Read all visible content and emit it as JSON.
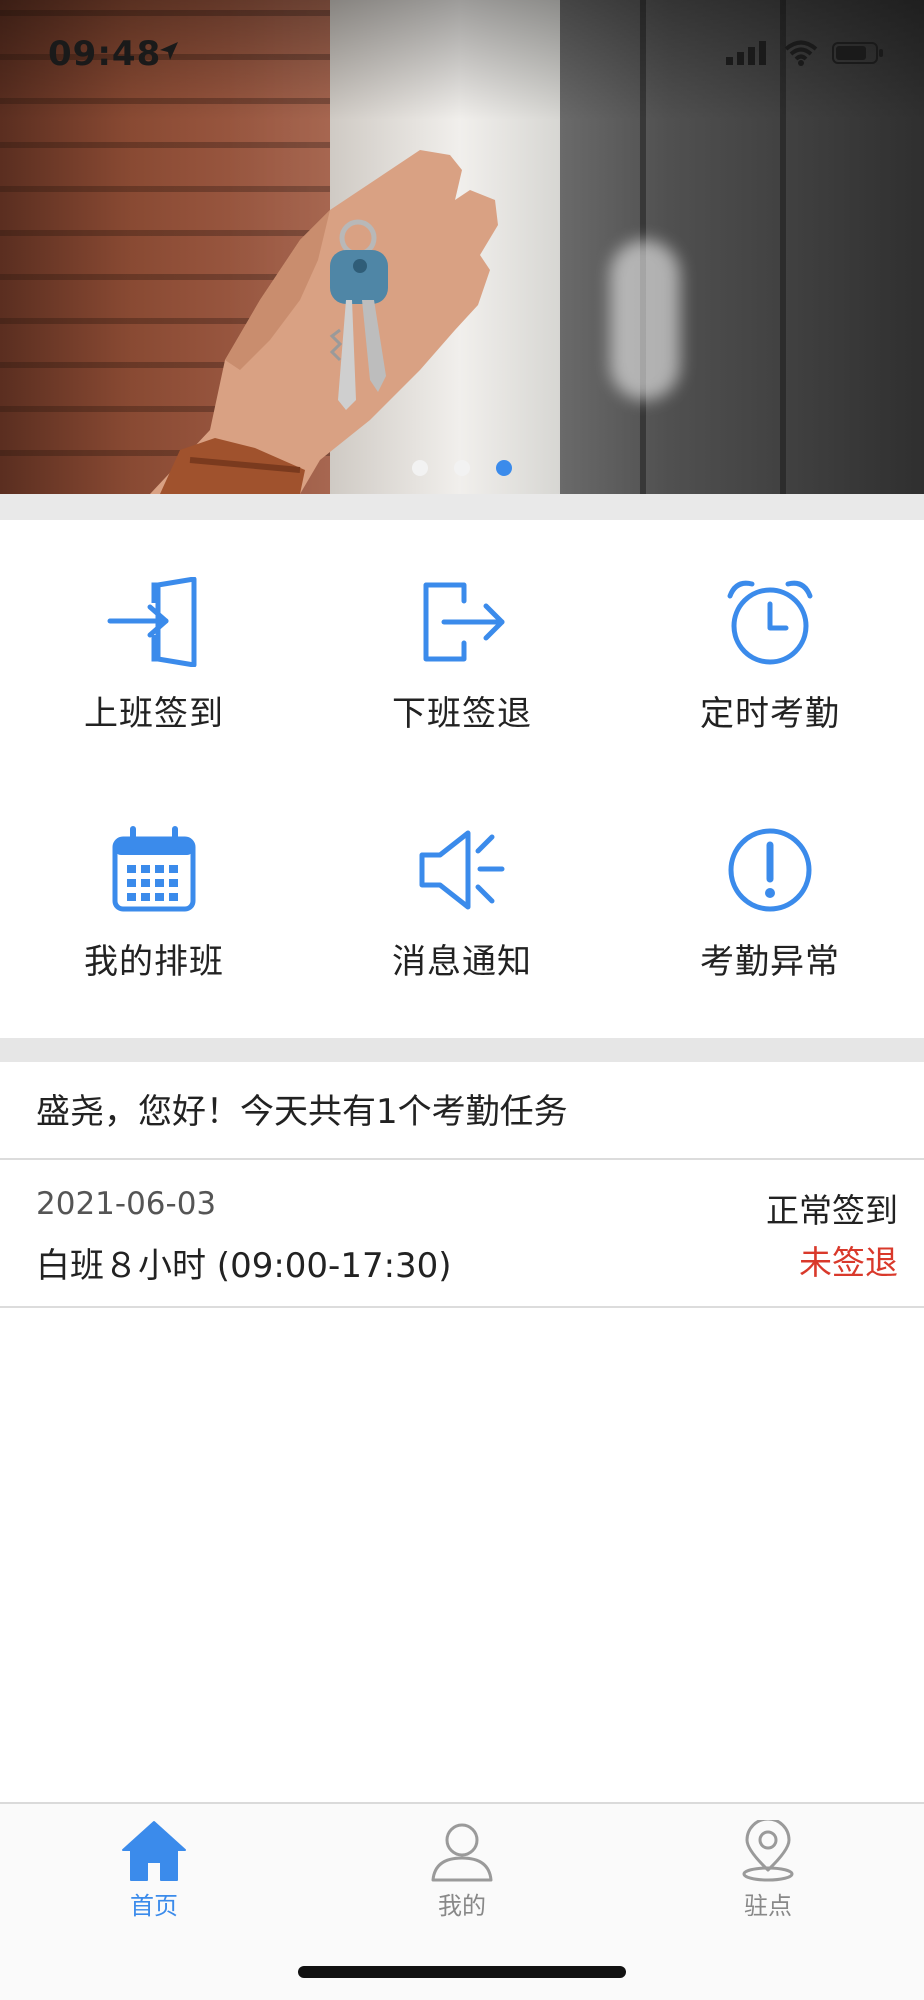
{
  "status_bar": {
    "time": "09:48"
  },
  "banner": {
    "page_count": 3,
    "active_index": 2
  },
  "grid": {
    "items": [
      {
        "label": "上班签到",
        "icon": "check-in-icon"
      },
      {
        "label": "下班签退",
        "icon": "check-out-icon"
      },
      {
        "label": "定时考勤",
        "icon": "alarm-clock-icon"
      },
      {
        "label": "我的排班",
        "icon": "calendar-icon"
      },
      {
        "label": "消息通知",
        "icon": "speaker-icon"
      },
      {
        "label": "考勤异常",
        "icon": "alert-circle-icon"
      }
    ]
  },
  "greeting": "盛尧，您好！今天共有1个考勤任务",
  "task": {
    "date": "2021-06-03",
    "shift": "白班８小时 (09:00-17:30)",
    "status_checkin": "正常签到",
    "status_checkout": "未签退"
  },
  "tabs": [
    {
      "label": "首页",
      "icon": "home-icon",
      "active": true
    },
    {
      "label": "我的",
      "icon": "user-icon",
      "active": false
    },
    {
      "label": "驻点",
      "icon": "location-pin-icon",
      "active": false
    }
  ],
  "colors": {
    "accent": "#3b8beb",
    "alert": "#d9392b"
  }
}
